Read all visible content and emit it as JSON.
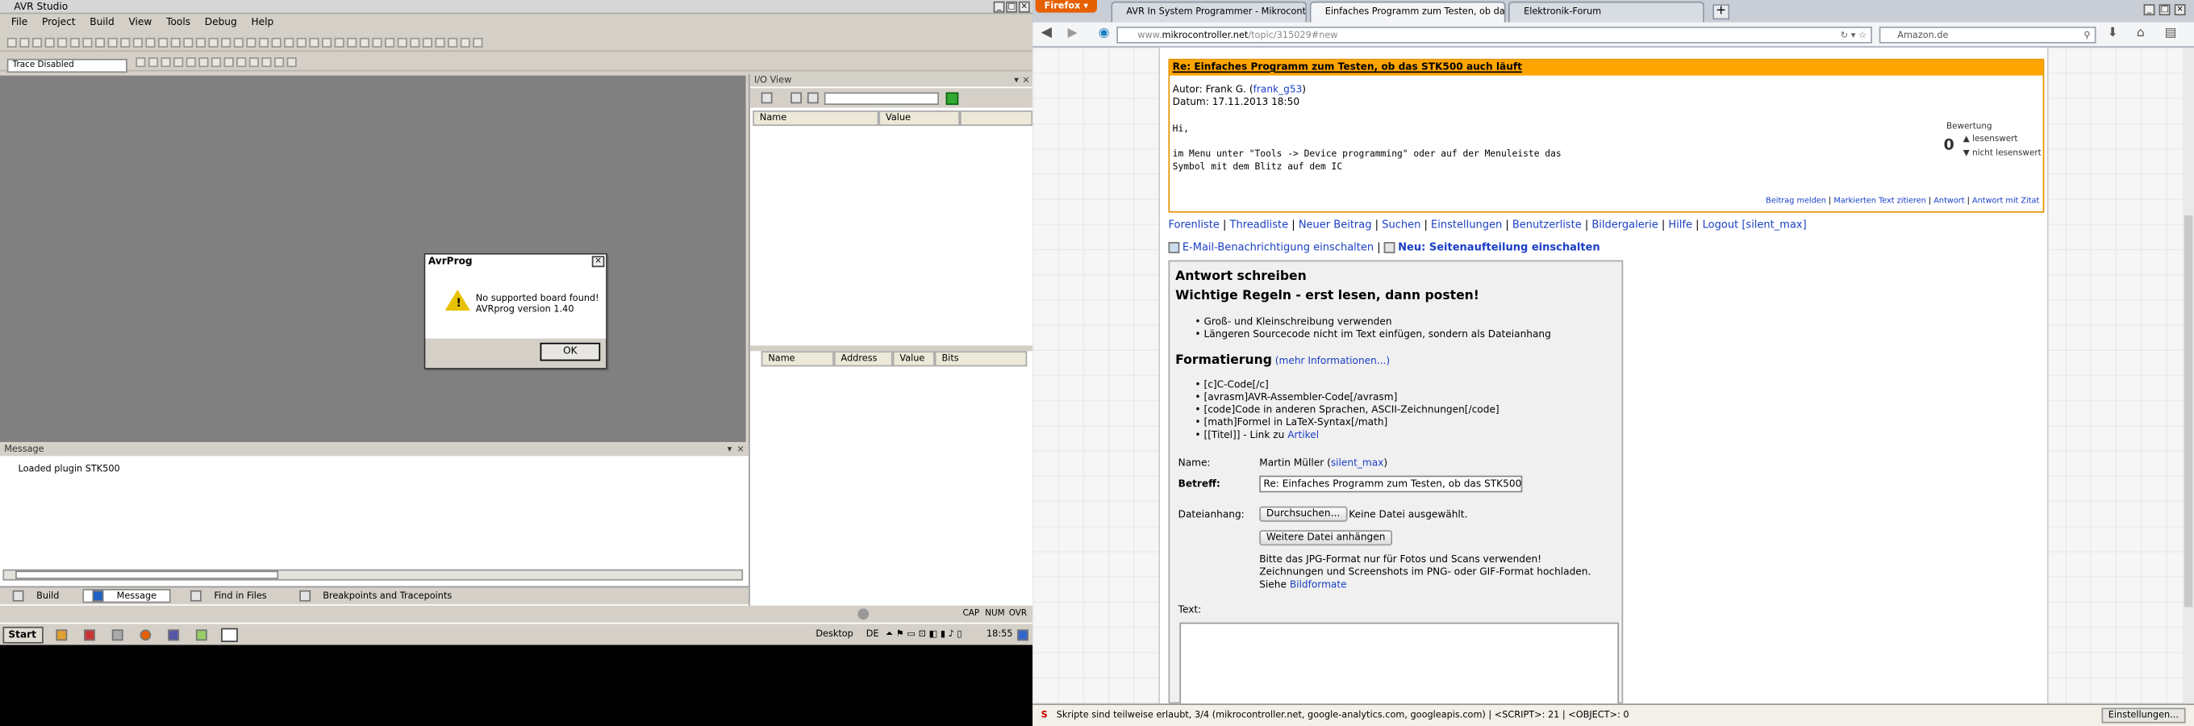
{
  "avr": {
    "title": "AVR Studio",
    "menu": [
      "File",
      "Project",
      "Build",
      "View",
      "Tools",
      "Debug",
      "Help"
    ],
    "trace_select": "Trace Disabled",
    "io_view": {
      "title": "I/O View",
      "col_name": "Name",
      "col_value": "Value",
      "reg_cols": [
        "Name",
        "Address",
        "Value",
        "Bits"
      ]
    },
    "message": {
      "title": "Message",
      "line": "Loaded plugin STK500"
    },
    "tabs": [
      "Build",
      "Message",
      "Find in Files",
      "Breakpoints and Tracepoints"
    ],
    "status": {
      "caps": "CAP",
      "num": "NUM",
      "ovr": "OVR"
    },
    "taskbar": {
      "start": "Start",
      "desktop": "Desktop",
      "lang": "DE",
      "clock": "18:55"
    },
    "dialog": {
      "title": "AvrProg",
      "line1": "No supported board found!",
      "line2": "AVRprog version 1.40",
      "ok": "OK"
    }
  },
  "firefox": {
    "menu_button": "Firefox",
    "tabs": [
      "AVR In System Programmer - Mikrocontro...",
      "Einfaches Programm zum Testen, ob das ...",
      "Elektronik-Forum"
    ],
    "url_prefix": "www.",
    "url_host": "mikrocontroller.net",
    "url_path": "/topic/315029#new",
    "search_placeholder": "Amazon.de",
    "status_text": "Skripte sind teilweise erlaubt, 3/4 (mikrocontroller.net, google-analytics.com, googleapis.com) | <SCRIPT>: 21 | <OBJECT>: 0",
    "settings_button": "Einstellungen..."
  },
  "post": {
    "subject": "Re: Einfaches Programm zum Testen, ob das STK500 auch läuft",
    "author_label": "Autor: Frank G. (",
    "author_link": "frank_g53",
    "author_close": ")",
    "date": "Datum: 17.11.2013 18:50",
    "body": [
      "Hi,",
      "",
      "im Menu unter \"Tools -> Device programming\" oder auf der Menuleiste das",
      "Symbol mit dem Blitz auf dem IC"
    ],
    "rating_title": "Bewertung",
    "rating_value": "0",
    "rating_up": "lesenswert",
    "rating_down": "nicht lesenswert",
    "actions": [
      "Beitrag melden",
      "Markierten Text zitieren",
      "Antwort",
      "Antwort mit Zitat"
    ]
  },
  "forum_nav": [
    "Forenliste",
    "Threadliste",
    "Neuer Beitrag",
    "Suchen",
    "Einstellungen",
    "Benutzerliste",
    "Bildergalerie",
    "Hilfe",
    "Logout [silent_max]"
  ],
  "notify": {
    "email": "E-Mail-Benachrichtigung einschalten",
    "layout": "Neu: Seitenaufteilung einschalten"
  },
  "reply": {
    "heading": "Antwort schreiben",
    "rules_heading": "Wichtige Regeln - erst lesen, dann posten!",
    "rules": [
      "Groß- und Kleinschreibung verwenden",
      "Längeren Sourcecode nicht im Text einfügen, sondern als Dateianhang"
    ],
    "format_heading": "Formatierung",
    "format_more": "(mehr Informationen...)",
    "format_items": [
      "[c]C-Code[/c]",
      "[avrasm]AVR-Assembler-Code[/avrasm]",
      "[code]Code in anderen Sprachen, ASCII-Zeichnungen[/code]",
      "[math]Formel in LaTeX-Syntax[/math]",
      "[[Titel]] - Link zu "
    ],
    "format_link": "Artikel",
    "name_label": "Name:",
    "name_value": "Martin Müller (",
    "name_link": "silent_max",
    "name_close": ")",
    "subject_label": "Betreff:",
    "subject_value": "Re: Einfaches Programm zum Testen, ob das STK500",
    "attach_label": "Dateianhang:",
    "browse": "Durchsuchen...",
    "no_file": "Keine Datei ausgewählt.",
    "more_files": "Weitere Datei anhängen",
    "hint1": "Bitte das JPG-Format nur für Fotos und Scans verwenden!",
    "hint2": "Zeichnungen und Screenshots im PNG- oder GIF-Format hochladen.",
    "hint3": "Siehe ",
    "hint_link": "Bildformate",
    "text_label": "Text:"
  }
}
